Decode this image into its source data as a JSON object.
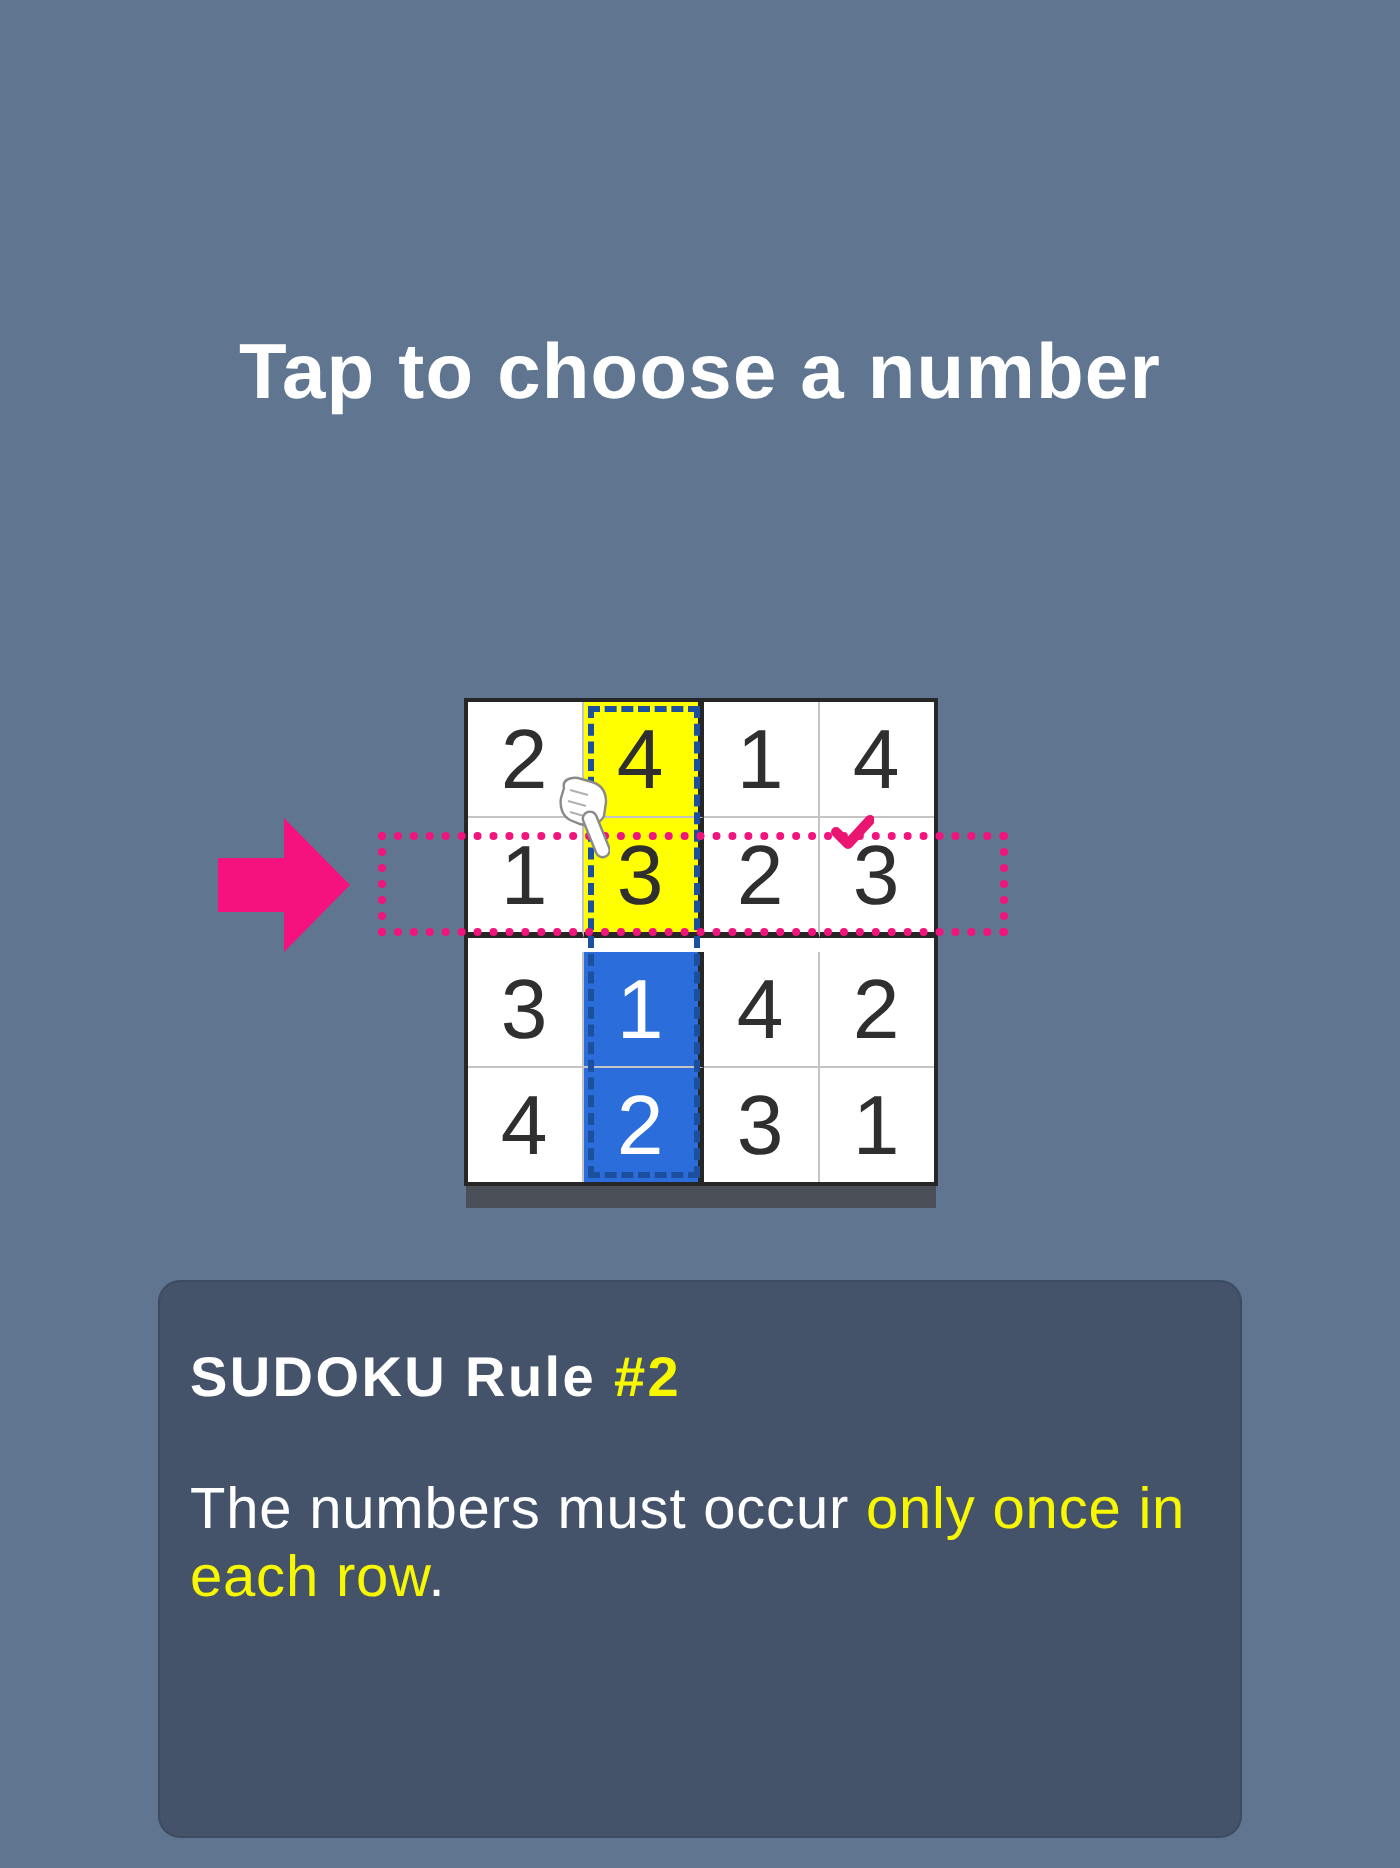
{
  "title": "Tap to choose a number",
  "grid": {
    "columns": [
      {
        "outlined": false
      },
      {
        "outlined": true
      },
      {
        "outlined": false
      },
      {
        "outlined": false
      }
    ],
    "rows": [
      {
        "outlined": false,
        "cells": [
          {
            "value": "2",
            "color": "#ffffff",
            "tapped": false,
            "checked": false
          },
          {
            "value": "4",
            "color": "#ffff00",
            "tapped": false,
            "checked": false
          },
          {
            "value": "1",
            "color": "#ffffff",
            "tapped": false,
            "checked": false
          },
          {
            "value": "4",
            "color": "#ffffff",
            "tapped": false,
            "checked": false
          }
        ]
      },
      {
        "outlined": true,
        "cells": [
          {
            "value": "1",
            "color": "#ffffff",
            "tapped": false,
            "checked": false
          },
          {
            "value": "3",
            "color": "#ffff00",
            "tapped": true,
            "checked": false
          },
          {
            "value": "2",
            "color": "#ffffff",
            "tapped": false,
            "checked": false
          },
          {
            "value": "3",
            "color": "#ffffff",
            "tapped": false,
            "checked": true
          }
        ]
      },
      {
        "outlined": false,
        "cells": [
          {
            "value": "3",
            "color": "#ffffff",
            "tapped": false,
            "checked": false
          },
          {
            "value": "1",
            "color": "#2b6edb",
            "tapped": false,
            "checked": false
          },
          {
            "value": "4",
            "color": "#ffffff",
            "tapped": false,
            "checked": false
          },
          {
            "value": "2",
            "color": "#ffffff",
            "tapped": false,
            "checked": false
          }
        ]
      },
      {
        "outlined": false,
        "cells": [
          {
            "value": "4",
            "color": "#ffffff",
            "tapped": false,
            "checked": false
          },
          {
            "value": "2",
            "color": "#2b6edb",
            "tapped": false,
            "checked": false
          },
          {
            "value": "3",
            "color": "#ffffff",
            "tapped": false,
            "checked": false
          },
          {
            "value": "1",
            "color": "#ffffff",
            "tapped": false,
            "checked": false
          }
        ]
      }
    ]
  },
  "rule": {
    "heading": "SUDOKU Rule **#2**",
    "text": "The numbers must occur **only once in each row**."
  }
}
